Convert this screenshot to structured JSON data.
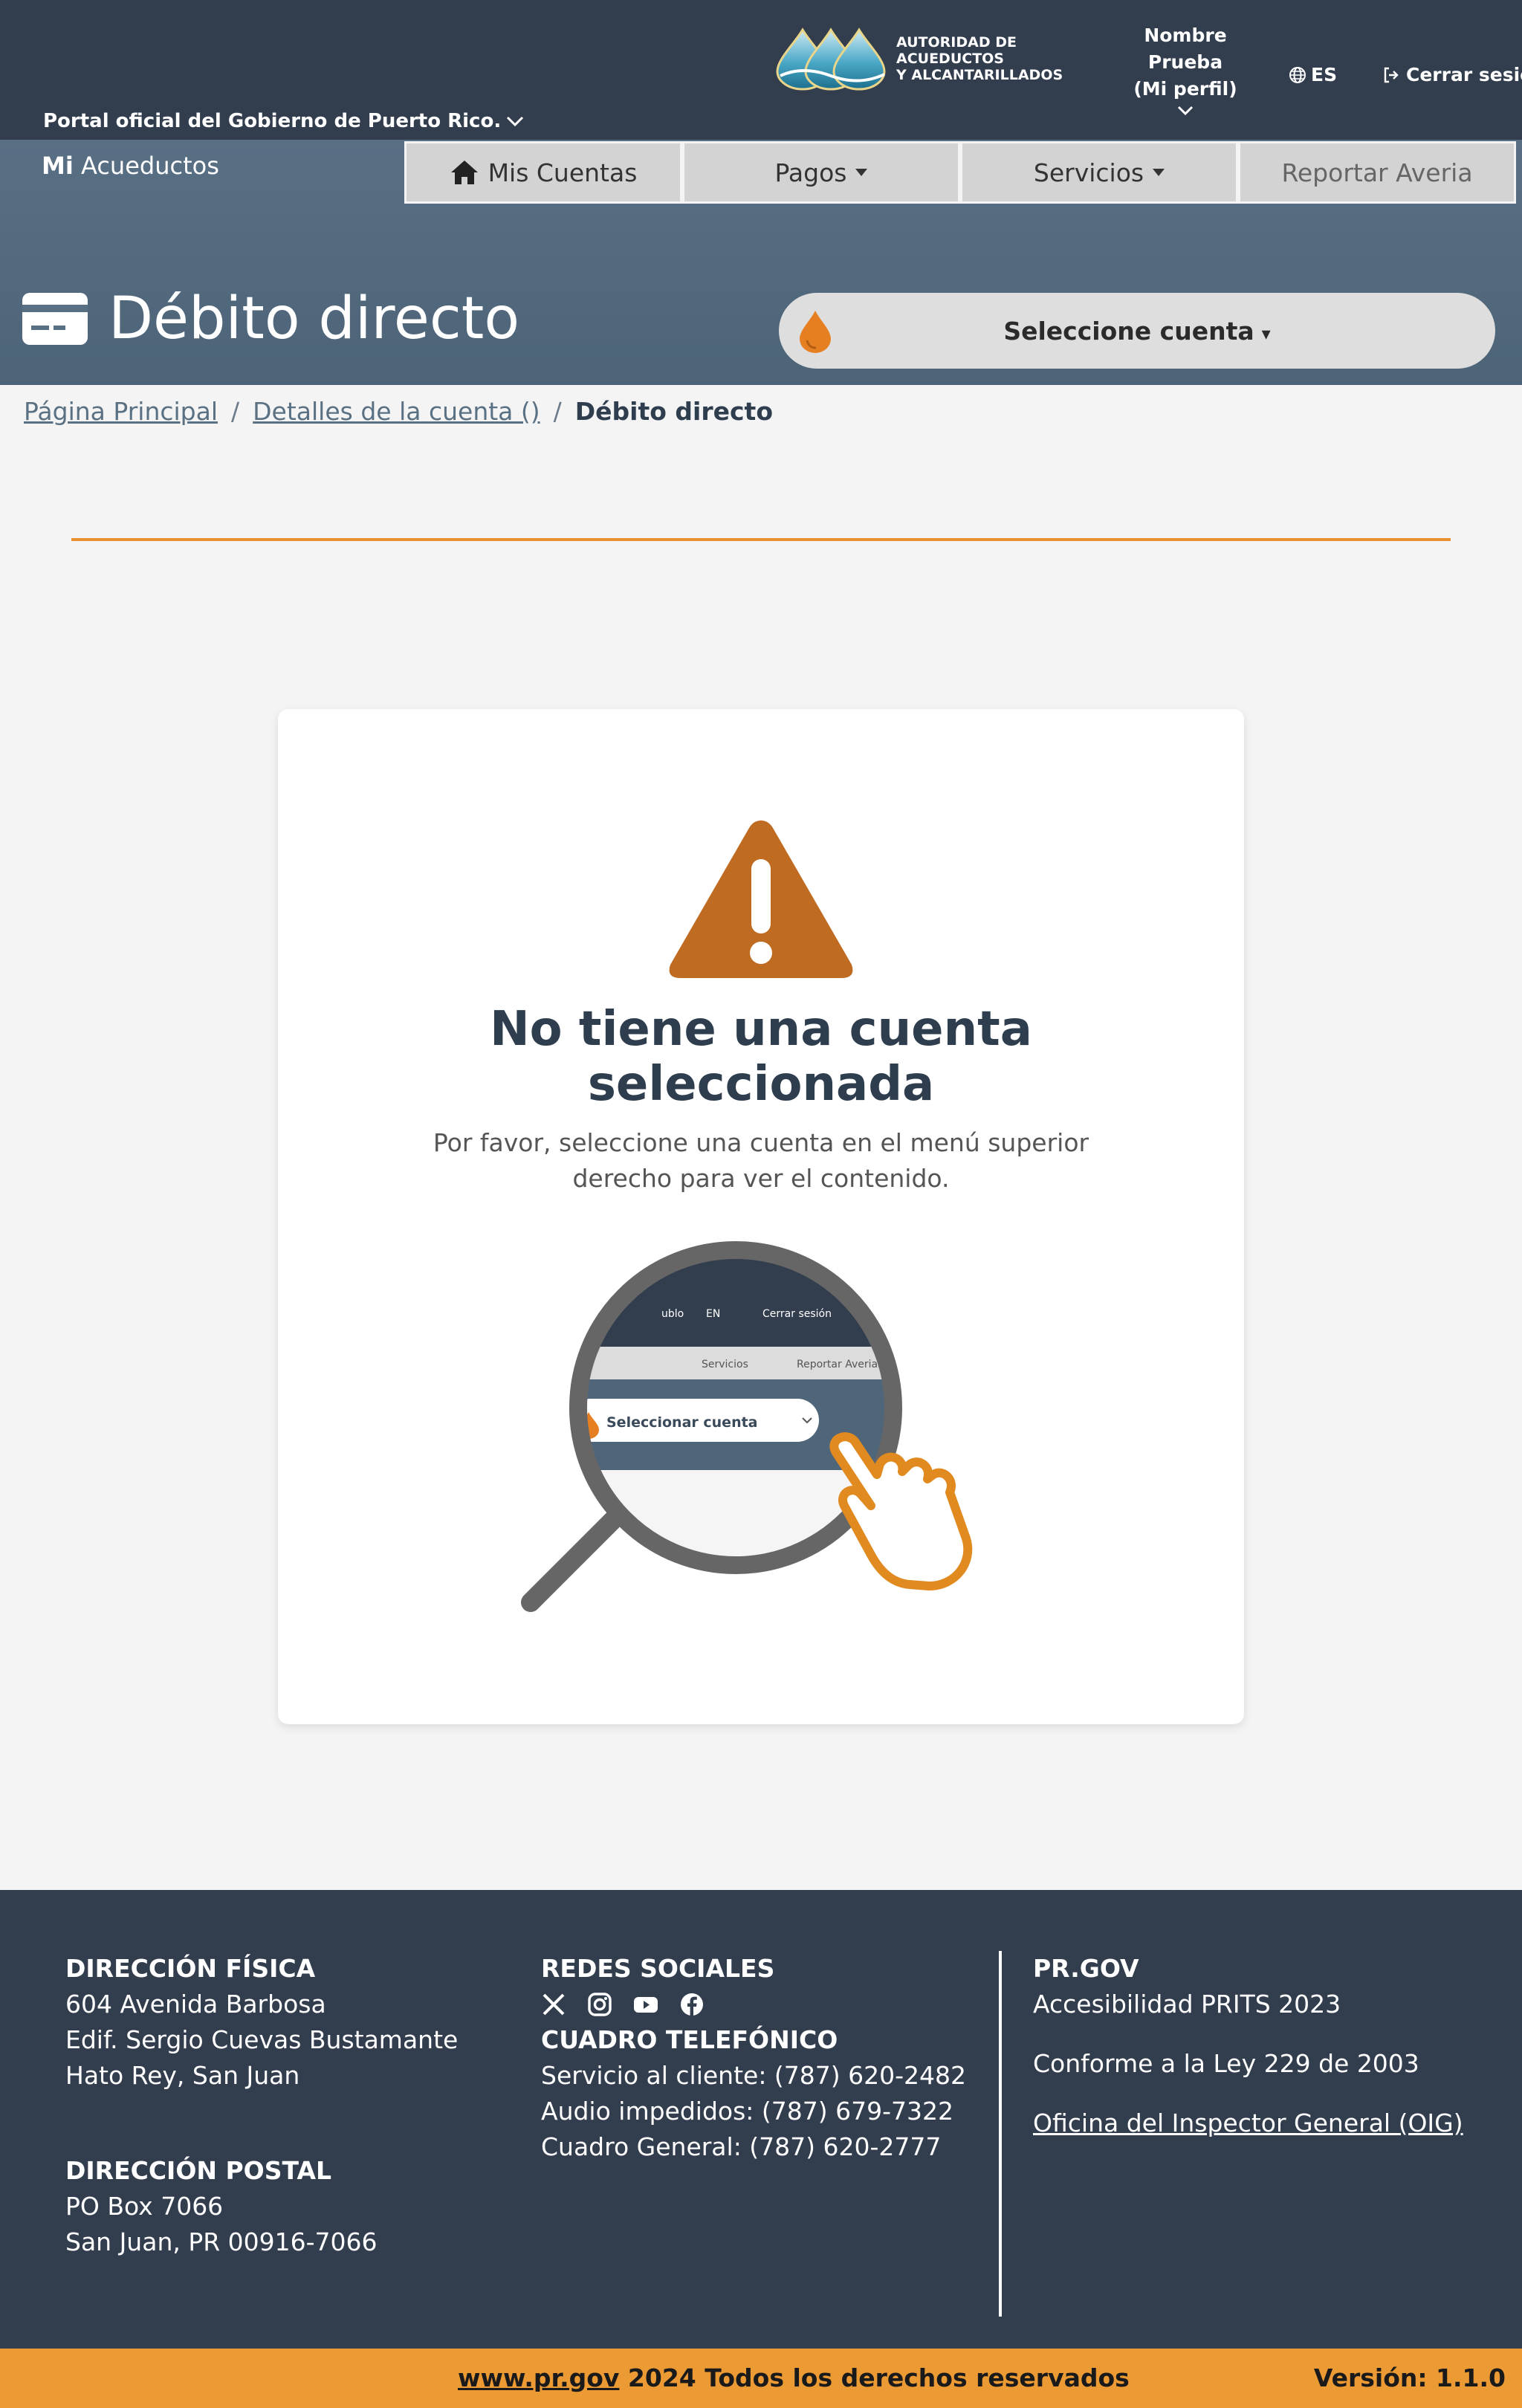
{
  "header": {
    "gov_link": "Portal oficial del Gobierno de Puerto Rico.",
    "logo_text_1": "AUTORIDAD DE ACUEDUCTOS",
    "logo_text_2": "Y ALCANTARILLADOS",
    "profile_line1": "Nombre",
    "profile_line2": "Prueba",
    "profile_line3": "(Mi perfil)",
    "language": "ES",
    "logout": "Cerrar sesión"
  },
  "nav": {
    "brand_bold": "Mi",
    "brand_rest": " Acueductos",
    "items": [
      {
        "label": "Mis Cuentas"
      },
      {
        "label": "Pagos"
      },
      {
        "label": "Servicios"
      },
      {
        "label": "Reportar Averia"
      }
    ]
  },
  "page": {
    "title": "Débito directo",
    "account_select": "Seleccione cuenta",
    "account_select_caret": "▾"
  },
  "breadcrumb": {
    "home": "Página Principal",
    "details": "Detalles de la cuenta ()",
    "current": "Débito directo",
    "separator": "/"
  },
  "card": {
    "title_line1": "No tiene una cuenta",
    "title_line2": "seleccionada",
    "subtitle": "Por favor, seleccione una cuenta en el menú superior derecho para ver el contenido.",
    "illustration": {
      "top_items": [
        "ublo",
        "EN",
        "Cerrar sesión"
      ],
      "nav_items": [
        "Servicios",
        "Reportar Averias"
      ],
      "select_label": "Seleccionar cuenta"
    }
  },
  "footer": {
    "physical_title": "DIRECCIÓN FÍSICA",
    "physical_lines": [
      "604 Avenida Barbosa",
      "Edif. Sergio Cuevas Bustamante",
      "Hato Rey, San Juan"
    ],
    "postal_title": "DIRECCIÓN POSTAL",
    "postal_lines": [
      "PO Box 7066",
      "San Juan, PR 00916-7066"
    ],
    "social_title": "REDES SOCIALES",
    "social_icons": [
      "x-icon",
      "instagram-icon",
      "youtube-icon",
      "facebook-icon"
    ],
    "phone_title": "CUADRO TELEFÓNICO",
    "phone_lines": [
      "Servicio al cliente: (787) 620-2482",
      "Audio impedidos: (787) 679-7322",
      "Cuadro General: (787) 620-2777"
    ],
    "prgov_title": "PR.GOV",
    "prgov_lines": [
      "Accesibilidad PRITS 2023",
      "Conforme a la Ley 229 de 2003"
    ],
    "oig_link": "Oficina del Inspector General (OIG)"
  },
  "bottom": {
    "site_link": "www.pr.gov",
    "rights": " 2024 Todos los derechos reservados",
    "version": "Versión: 1.1.0"
  },
  "colors": {
    "header_bg": "#323d4d",
    "hero_bg": "#596f84",
    "accent_orange": "#ec9a33",
    "warning_brown": "#c06b22"
  }
}
